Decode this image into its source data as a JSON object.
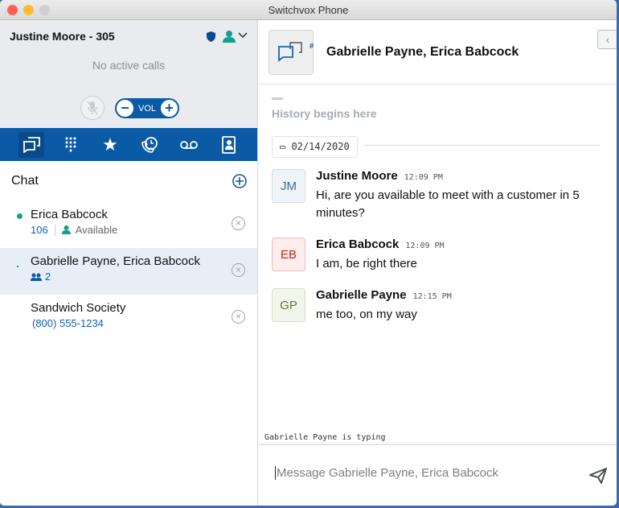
{
  "window": {
    "title": "Switchvox Phone"
  },
  "user": {
    "name": "Justine Moore - 305"
  },
  "calls": {
    "status": "No active calls",
    "vol_label": "VOL"
  },
  "nav": [
    "chat",
    "dialpad",
    "favorites",
    "call-history",
    "voicemail",
    "contacts"
  ],
  "chat_list": {
    "title": "Chat",
    "items": [
      {
        "name": "Erica Babcock",
        "ext": "106",
        "status": "Available"
      },
      {
        "name": "Gabrielle Payne, Erica Babcock",
        "members": "2"
      },
      {
        "name": "Sandwich Society",
        "phone": "(800) 555-1234"
      }
    ]
  },
  "conversation": {
    "title": "Gabrielle Payne, Erica Babcock",
    "history": "History begins here",
    "date": "02/14/2020",
    "messages": [
      {
        "initials": "JM",
        "sender": "Justine Moore",
        "time": "12:09 PM",
        "text": "Hi, are you available to meet with a customer in 5 minutes?"
      },
      {
        "initials": "EB",
        "sender": "Erica Babcock",
        "time": "12:09 PM",
        "text": "I am, be right there"
      },
      {
        "initials": "GP",
        "sender": "Gabrielle Payne",
        "time": "12:15 PM",
        "text": "me too, on my way"
      }
    ],
    "typing": "Gabrielle Payne is typing",
    "placeholder": "Message Gabrielle Payne, Erica Babcock"
  },
  "colors": {
    "brand": "#0b5aa5",
    "online": "#14a08e"
  }
}
